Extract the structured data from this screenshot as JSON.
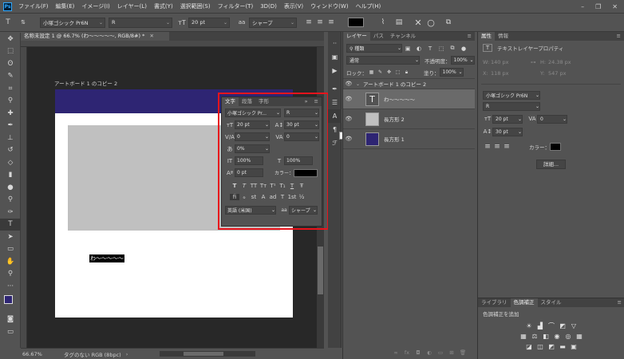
{
  "menubar": {
    "logo": "Ps",
    "items": [
      "ファイル(F)",
      "編集(E)",
      "イメージ(I)",
      "レイヤー(L)",
      "書式(Y)",
      "選択範囲(S)",
      "フィルター(T)",
      "3D(D)",
      "表示(V)",
      "ウィンドウ(W)",
      "ヘルプ(H)"
    ],
    "window_controls": [
      "–",
      "❐",
      "✕"
    ]
  },
  "options": {
    "font_family": "小塚ゴシック Pr6N",
    "font_style": "R",
    "font_size": "20 pt",
    "antialias": "シャープ",
    "text_color": "#000000"
  },
  "document": {
    "tab_title": "名称未設定 1 @ 66.7% (わ〜〜〜〜〜, RGB/8#) *",
    "artboard_label": "アートボード 1 のコピー 2",
    "selected_text": "わ〜〜〜〜〜",
    "banner_color": "#2e2573",
    "rect_color": "#c0c0c0"
  },
  "status": {
    "zoom": "66.67%",
    "profile": "タグのない RGB (8bpc)"
  },
  "character_panel": {
    "tabs": [
      "文字",
      "段落",
      "字形"
    ],
    "font_family": "小塚ゴシック Pr...",
    "font_style": "R",
    "font_size": "20 pt",
    "leading": "30 pt",
    "kerning": "0",
    "tracking": "0",
    "tsume": "0%",
    "vscale": "100%",
    "hscale": "100%",
    "baseline": "0 pt",
    "color_label": "カラー：",
    "style_glyphs": [
      "T",
      "T",
      "TT",
      "Tт",
      "T¹",
      "T₁",
      "T",
      "Ŧ"
    ],
    "opentype_glyphs": [
      "fi",
      "ℴ",
      "st",
      "A",
      "ad",
      "T",
      "1st",
      "½"
    ],
    "language": "英語 (米国)",
    "aa_label": "aa",
    "antialias": "シャープ"
  },
  "tooltip": "段落",
  "layers_panel": {
    "tabs": [
      "レイヤー",
      "パス",
      "チャンネル"
    ],
    "filter_kind": "種類",
    "blend_mode": "通常",
    "opacity_label": "不透明度：",
    "opacity": "100%",
    "lock_label": "ロック：",
    "fill_label": "塗り：",
    "fill": "100%",
    "group_name": "アートボード 1 のコピー 2",
    "layers": [
      {
        "name": "わ〜〜〜〜〜",
        "kind": "text"
      },
      {
        "name": "長方形 2",
        "kind": "shape"
      },
      {
        "name": "長方形 1",
        "kind": "shape"
      }
    ]
  },
  "properties_panel": {
    "tabs": [
      "属性",
      "情報"
    ],
    "header": "テキストレイヤープロパティ",
    "W": "140 px",
    "H": "24.38 px",
    "X": "118 px",
    "Y": "547 px",
    "font_family": "小塚ゴシック Pr6N",
    "font_style": "R",
    "font_size": "20 pt",
    "tracking": "0",
    "leading": "30 pt",
    "color_label": "カラー：",
    "details_button": "詳細...",
    "bottom_tabs": [
      "ライブラリ",
      "色調補正",
      "スタイル"
    ],
    "adjust_label": "色調補正を追加"
  }
}
